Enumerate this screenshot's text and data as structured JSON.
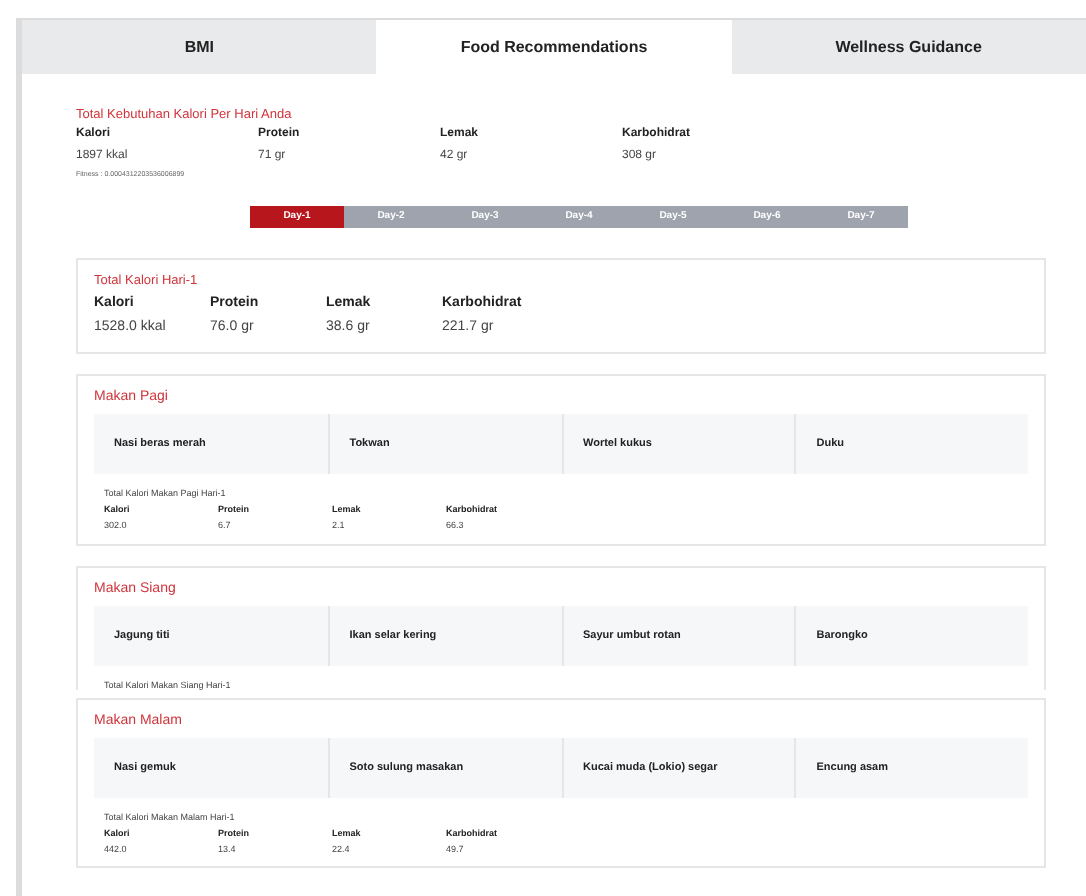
{
  "tabs": [
    {
      "label": "BMI",
      "selected": false
    },
    {
      "label": "Food Recommendations",
      "selected": true
    },
    {
      "label": "Wellness Guidance",
      "selected": false
    }
  ],
  "needs": {
    "title": "Total Kebutuhan Kalori Per Hari Anda",
    "stats": [
      {
        "label": "Kalori",
        "value": "1897 kkal"
      },
      {
        "label": "Protein",
        "value": "71 gr"
      },
      {
        "label": "Lemak",
        "value": "42 gr"
      },
      {
        "label": "Karbohidrat",
        "value": "308 gr"
      }
    ],
    "fitness": "Fitness : 0.0004312203536006899"
  },
  "days": [
    {
      "label": "Day-1",
      "selected": true
    },
    {
      "label": "Day-2",
      "selected": false
    },
    {
      "label": "Day-3",
      "selected": false
    },
    {
      "label": "Day-4",
      "selected": false
    },
    {
      "label": "Day-5",
      "selected": false
    },
    {
      "label": "Day-6",
      "selected": false
    },
    {
      "label": "Day-7",
      "selected": false
    }
  ],
  "day_total": {
    "title": "Total Kalori Hari-1",
    "stats": [
      {
        "label": "Kalori",
        "value": "1528.0 kkal"
      },
      {
        "label": "Protein",
        "value": "76.0 gr"
      },
      {
        "label": "Lemak",
        "value": "38.6 gr"
      },
      {
        "label": "Karbohidrat",
        "value": "221.7 gr"
      }
    ]
  },
  "meals": [
    {
      "title": "Makan Pagi",
      "foods": [
        "Nasi beras merah",
        "Tokwan",
        "Wortel kukus",
        "Duku"
      ],
      "total_title": "Total Kalori Makan Pagi Hari-1",
      "stats": [
        {
          "label": "Kalori",
          "value": "302.0"
        },
        {
          "label": "Protein",
          "value": "6.7"
        },
        {
          "label": "Lemak",
          "value": "2.1"
        },
        {
          "label": "Karbohidrat",
          "value": "66.3"
        }
      ]
    },
    {
      "title": "Makan Siang",
      "foods": [
        "Jagung titi",
        "Ikan selar kering",
        "Sayur umbut rotan",
        "Barongko"
      ],
      "total_title": "Total Kalori Makan Siang Hari-1"
    },
    {
      "title": "Makan Malam",
      "foods": [
        "Nasi gemuk",
        "Soto sulung masakan",
        "Kucai muda (Lokio) segar",
        "Encung asam"
      ],
      "total_title": "Total Kalori Makan Malam Hari-1",
      "stats": [
        {
          "label": "Kalori",
          "value": "442.0"
        },
        {
          "label": "Protein",
          "value": "13.4"
        },
        {
          "label": "Lemak",
          "value": "22.4"
        },
        {
          "label": "Karbohidrat",
          "value": "49.7"
        }
      ]
    }
  ]
}
